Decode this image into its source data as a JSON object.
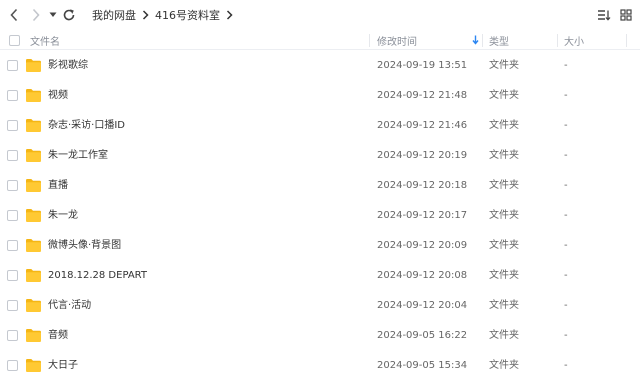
{
  "breadcrumb": [
    "我的网盘",
    "416号资料室"
  ],
  "columns": {
    "name": "文件名",
    "modified": "修改时间",
    "type": "类型",
    "size": "大小"
  },
  "files": [
    {
      "name": "影视歌综",
      "modified": "2024-09-19 13:51",
      "type": "文件夹",
      "size": "-"
    },
    {
      "name": "视频",
      "modified": "2024-09-12 21:48",
      "type": "文件夹",
      "size": "-"
    },
    {
      "name": "杂志·采访·口播ID",
      "modified": "2024-09-12 21:46",
      "type": "文件夹",
      "size": "-"
    },
    {
      "name": "朱一龙工作室",
      "modified": "2024-09-12 20:19",
      "type": "文件夹",
      "size": "-"
    },
    {
      "name": "直播",
      "modified": "2024-09-12 20:18",
      "type": "文件夹",
      "size": "-"
    },
    {
      "name": "朱一龙",
      "modified": "2024-09-12 20:17",
      "type": "文件夹",
      "size": "-"
    },
    {
      "name": "微博头像·背景图",
      "modified": "2024-09-12 20:09",
      "type": "文件夹",
      "size": "-"
    },
    {
      "name": "2018.12.28 DEPART",
      "modified": "2024-09-12 20:08",
      "type": "文件夹",
      "size": "-"
    },
    {
      "name": "代言·活动",
      "modified": "2024-09-12 20:04",
      "type": "文件夹",
      "size": "-"
    },
    {
      "name": "音频",
      "modified": "2024-09-05 16:22",
      "type": "文件夹",
      "size": "-"
    },
    {
      "name": "大日子",
      "modified": "2024-09-05 15:34",
      "type": "文件夹",
      "size": "-"
    }
  ],
  "colors": {
    "folder": "#ffc933",
    "folder_tab": "#f5b614",
    "sort_arrow": "#2b86f2"
  }
}
